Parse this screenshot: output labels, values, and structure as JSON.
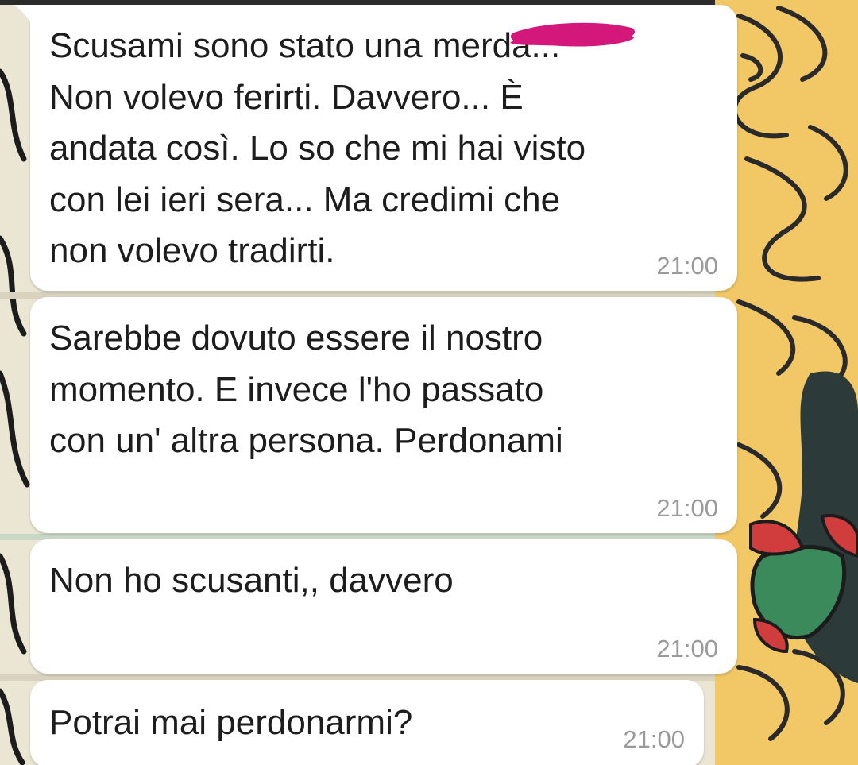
{
  "chat": {
    "messages": [
      {
        "text": "Scusami sono stato una merda...\nNon volevo ferirti. Davvero... È\nandata così. Lo so che mi hai visto\ncon lei ieri sera... Ma credimi che\nnon volevo tradirti.",
        "time": "21:00",
        "redacted_word": "merda"
      },
      {
        "text": "Sarebbe dovuto essere il nostro\nmomento. E invece l'ho passato\ncon un' altra persona. Perdonami",
        "time": "21:00"
      },
      {
        "text": "Non ho scusanti,, davvero",
        "time": "21:00"
      },
      {
        "text": "Potrai mai perdonarmi?",
        "time": "21:00"
      }
    ]
  },
  "colors": {
    "bubble": "#ffffff",
    "text": "#1d1d1d",
    "timestamp": "#9a9a9a",
    "redaction": "#d4177a"
  }
}
